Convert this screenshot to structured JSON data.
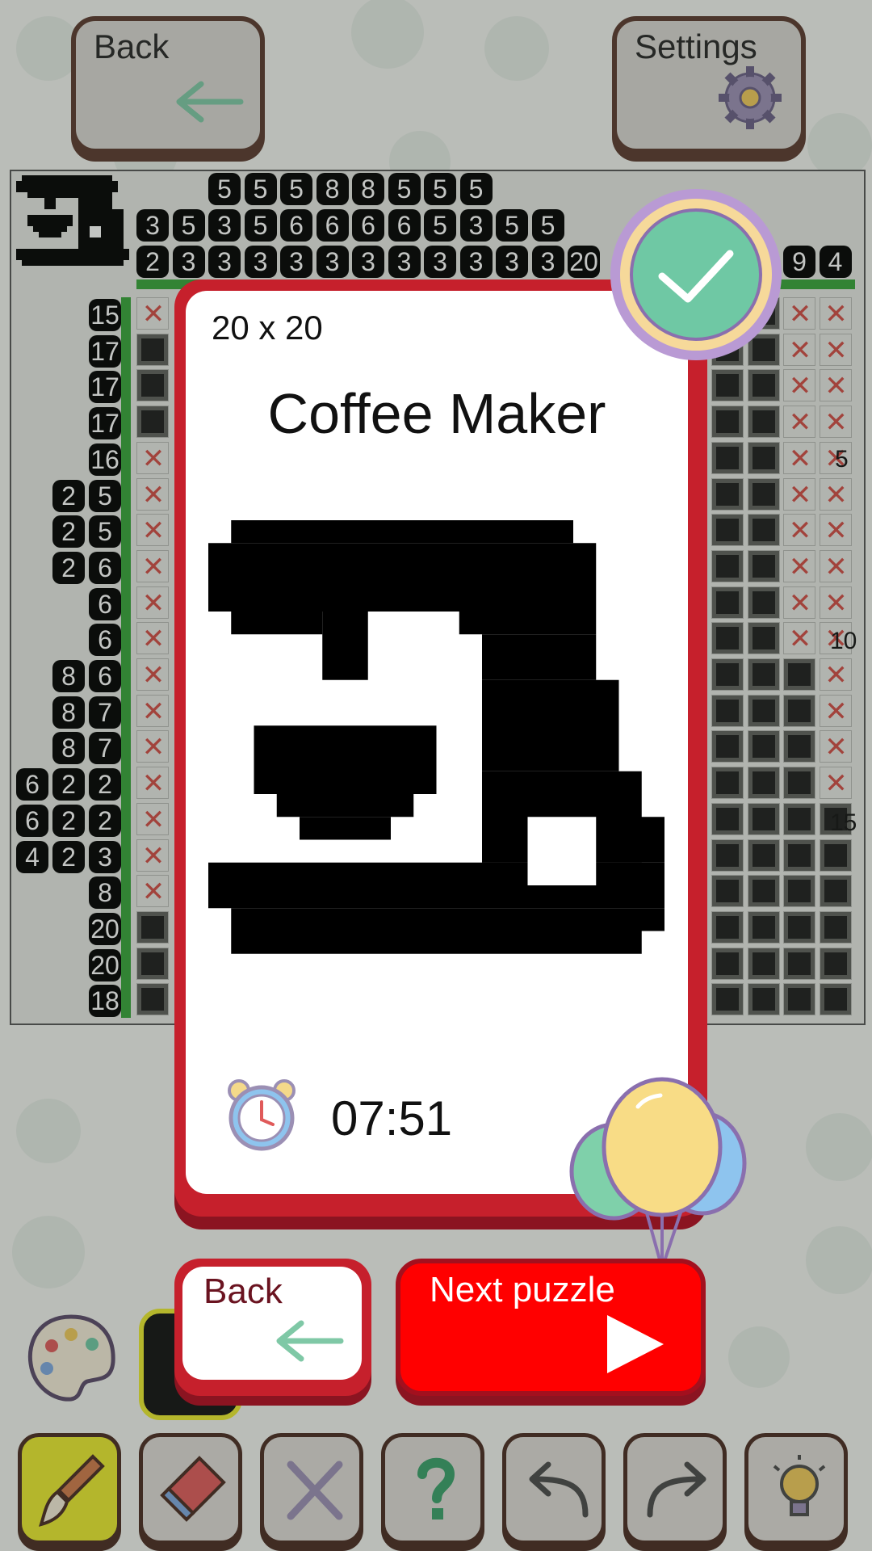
{
  "header": {
    "back_label": "Back",
    "settings_label": "Settings"
  },
  "board": {
    "col_clues_row1": [
      "5",
      "5",
      "5",
      "8",
      "8",
      "5",
      "5",
      "5"
    ],
    "col_clues_row2": [
      "3",
      "5",
      "3",
      "5",
      "6",
      "6",
      "6",
      "6",
      "5",
      "3",
      "5",
      "5"
    ],
    "col_clues_row3": [
      "2",
      "3",
      "3",
      "3",
      "3",
      "3",
      "3",
      "3",
      "3",
      "3",
      "3",
      "3",
      "20"
    ],
    "col_clues_right": [
      "9",
      "4"
    ],
    "row_clues": [
      [
        "15"
      ],
      [
        "17"
      ],
      [
        "17"
      ],
      [
        "17"
      ],
      [
        "16"
      ],
      [
        "2",
        "5"
      ],
      [
        "2",
        "5"
      ],
      [
        "2",
        "6"
      ],
      [
        "6"
      ],
      [
        "6"
      ],
      [
        "8",
        "6"
      ],
      [
        "8",
        "7"
      ],
      [
        "8",
        "7"
      ],
      [
        "6",
        "2",
        "2"
      ],
      [
        "6",
        "2",
        "2"
      ],
      [
        "4",
        "2",
        "3"
      ],
      [
        "8"
      ],
      [
        "20"
      ],
      [
        "20"
      ],
      [
        "18"
      ]
    ],
    "row_markers": [
      "5",
      "10",
      "15"
    ]
  },
  "result": {
    "size_label": "20 x 20",
    "puzzle_title": "Coffee Maker",
    "timer": "07:51",
    "back_label": "Back",
    "next_label": "Next puzzle"
  },
  "tools": [
    "brush-tool",
    "eraser-tool",
    "cross-tool",
    "hint-question-tool",
    "undo-tool",
    "redo-tool",
    "lightbulb-tool"
  ],
  "colors": {
    "accent_red": "#ff0000",
    "card_border": "#c6202c",
    "check_green": "#6fc8a4",
    "tool_active": "#eaea2e"
  }
}
